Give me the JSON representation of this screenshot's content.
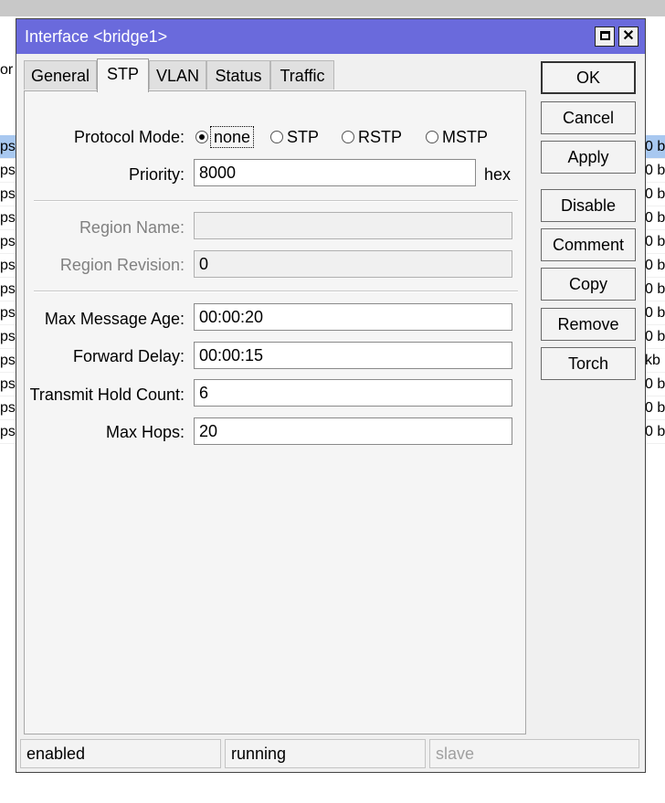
{
  "window": {
    "title": "Interface <bridge1>"
  },
  "tabs": [
    {
      "label": "General"
    },
    {
      "label": "STP"
    },
    {
      "label": "VLAN"
    },
    {
      "label": "Status"
    },
    {
      "label": "Traffic"
    }
  ],
  "protocol_mode": {
    "label": "Protocol Mode:",
    "options": [
      "none",
      "STP",
      "RSTP",
      "MSTP"
    ],
    "selected": "none"
  },
  "priority": {
    "label": "Priority:",
    "value": "8000",
    "suffix": "hex"
  },
  "region_name": {
    "label": "Region Name:",
    "value": ""
  },
  "region_revision": {
    "label": "Region Revision:",
    "value": "0"
  },
  "max_message_age": {
    "label": "Max Message Age:",
    "value": "00:00:20"
  },
  "forward_delay": {
    "label": "Forward Delay:",
    "value": "00:00:15"
  },
  "transmit_hold_count": {
    "label": "Transmit Hold Count:",
    "value": "6"
  },
  "max_hops": {
    "label": "Max Hops:",
    "value": "20"
  },
  "buttons": {
    "ok": "OK",
    "cancel": "Cancel",
    "apply": "Apply",
    "disable": "Disable",
    "comment": "Comment",
    "copy": "Copy",
    "remove": "Remove",
    "torch": "Torch"
  },
  "status_bar": {
    "state": "enabled",
    "running": "running",
    "slave": "slave"
  },
  "background": {
    "top_left_fragment": "or",
    "left_column": [
      "ps",
      "ps",
      "ps",
      "ps",
      "ps",
      "ps",
      "ps",
      "ps",
      "ps",
      "ps",
      "ps",
      "ps",
      "ps"
    ],
    "right_column": [
      "0 b",
      "0 b",
      "0 b",
      "0 b",
      "0 b",
      "0 b",
      "0 b",
      "0 b",
      "0 b",
      "kb",
      "0 b",
      "0 b",
      "0 b"
    ]
  }
}
